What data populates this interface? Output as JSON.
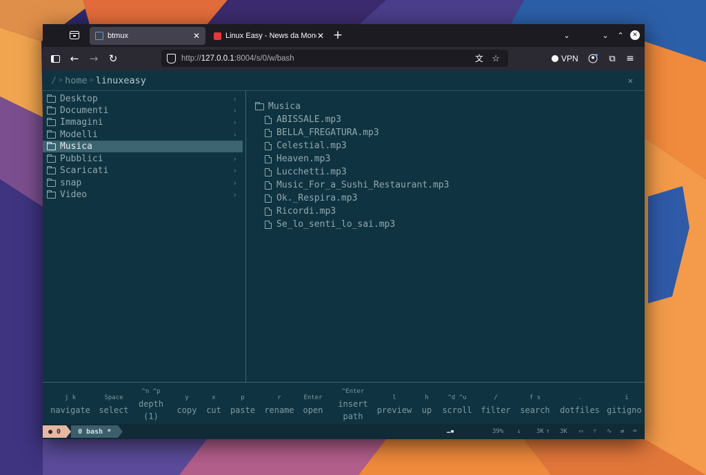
{
  "colors": {
    "accent_selection": "#3b6470",
    "terminal_bg": "#0f3340",
    "status_seg0": "#e6b8a2"
  },
  "tabs": [
    {
      "title": "btmux",
      "icon": "terminal-icon",
      "active": true
    },
    {
      "title": "Linux Easy - News da Mond",
      "icon": "linuxeasy-icon",
      "active": false
    }
  ],
  "url": {
    "scheme": "http://",
    "host": "127.0.0.1",
    "rest": ":8004/s/0/w/bash"
  },
  "vpn_label": "VPN",
  "breadcrumb": {
    "root": "/",
    "sep": ">",
    "home": "home",
    "user": "linuxeasy"
  },
  "left_items": [
    {
      "label": "Desktop"
    },
    {
      "label": "Documenti"
    },
    {
      "label": "Immagini"
    },
    {
      "label": "Modelli"
    },
    {
      "label": "Musica",
      "selected": true
    },
    {
      "label": "Pubblici"
    },
    {
      "label": "Scaricati"
    },
    {
      "label": "snap"
    },
    {
      "label": "Video"
    }
  ],
  "preview": {
    "folder": "Musica",
    "files": [
      "ABISSALE.mp3",
      "BELLA_FREGATURA.mp3",
      "Celestial.mp3",
      "Heaven.mp3",
      "Lucchetti.mp3",
      "Music_For_a_Sushi_Restaurant.mp3",
      "Ok._Respira.mp3",
      "Ricordi.mp3",
      "Se_lo_senti_lo_sai.mp3"
    ]
  },
  "keys": [
    {
      "key": "j  k",
      "desc": "navigate"
    },
    {
      "key": "Space",
      "desc": "select"
    },
    {
      "key": "^n  ^p",
      "desc": "depth",
      "extra": "(1)"
    },
    {
      "key": "y",
      "desc": "copy"
    },
    {
      "key": "x",
      "desc": "cut"
    },
    {
      "key": "p",
      "desc": "paste"
    },
    {
      "key": "r",
      "desc": "rename"
    },
    {
      "key": "Enter",
      "desc": "open"
    },
    {
      "key": "^Enter",
      "desc": "insert",
      "extra": "path"
    },
    {
      "key": "l",
      "desc": "preview"
    },
    {
      "key": "h",
      "desc": "up"
    },
    {
      "key": "^d  ^u",
      "desc": "scroll"
    },
    {
      "key": "/",
      "desc": "filter"
    },
    {
      "key": "f  s",
      "desc": "search"
    },
    {
      "key": ".",
      "desc": "dotfiles"
    },
    {
      "key": "i",
      "desc": "gitigno"
    }
  ],
  "status": {
    "session": "● 0",
    "window": "0 bash *",
    "cpu": "39%",
    "net_down": "3K",
    "net_up": "3K",
    "mem": "3K"
  }
}
